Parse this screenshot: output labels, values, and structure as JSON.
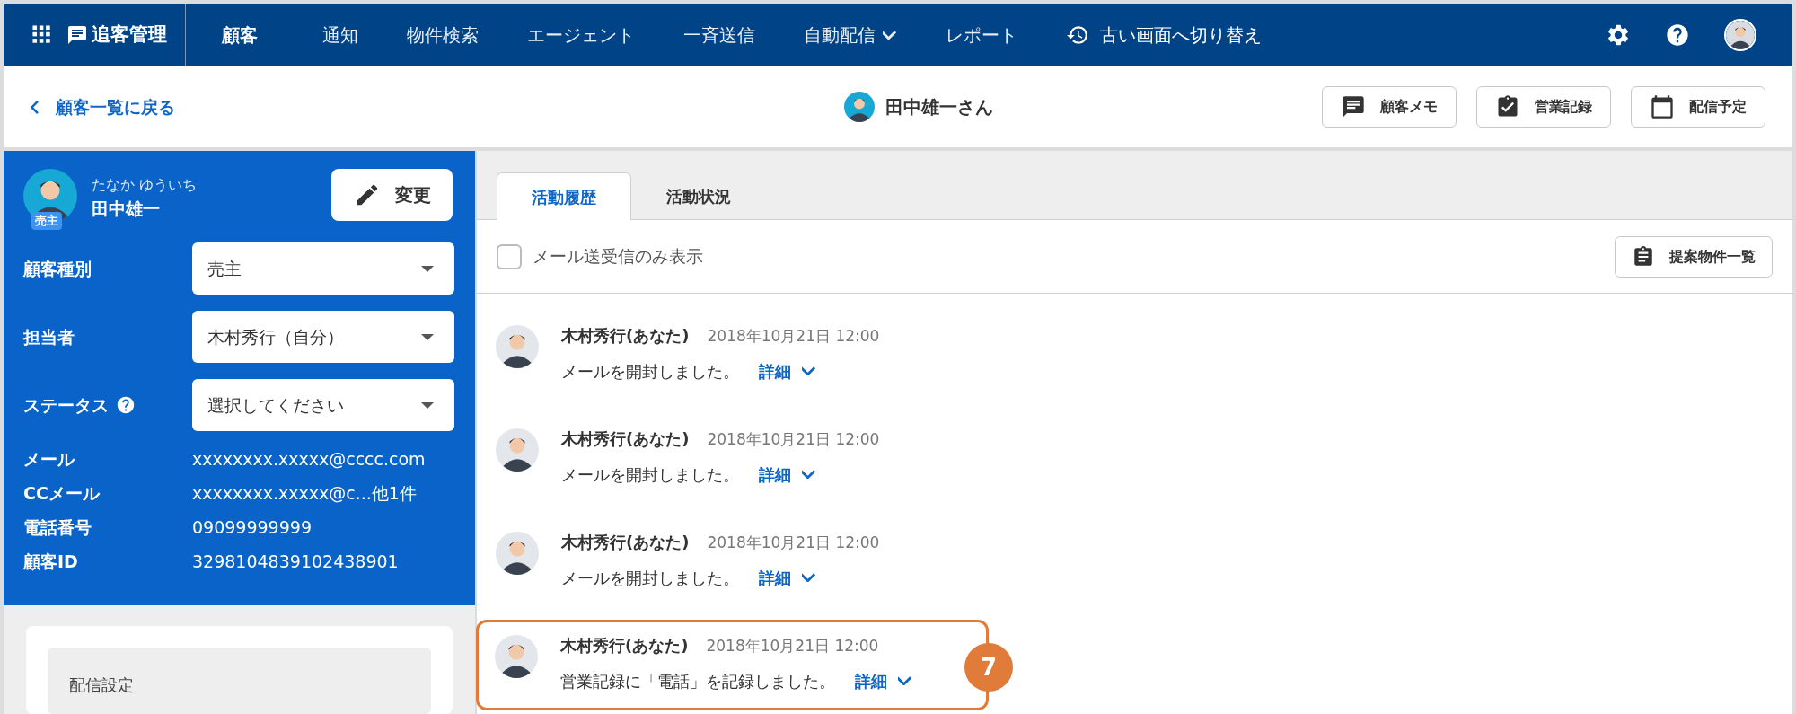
{
  "nav": {
    "app_name": "追客管理",
    "items": [
      {
        "label": "顧客",
        "selected": true,
        "has_menu": false
      },
      {
        "label": "通知",
        "selected": false,
        "has_menu": false
      },
      {
        "label": "物件検索",
        "selected": false,
        "has_menu": false
      },
      {
        "label": "エージェント",
        "selected": false,
        "has_menu": false
      },
      {
        "label": "一斉送信",
        "selected": false,
        "has_menu": false
      },
      {
        "label": "自動配信",
        "selected": false,
        "has_menu": true
      },
      {
        "label": "レポート",
        "selected": false,
        "has_menu": false
      }
    ],
    "switch_link": "古い画面へ切り替え"
  },
  "header": {
    "back_link": "顧客一覧に戻る",
    "customer_name": "田中雄一さん",
    "buttons": [
      {
        "label": "顧客メモ",
        "kind": "memo"
      },
      {
        "label": "営業記録",
        "kind": "record"
      },
      {
        "label": "配信予定",
        "kind": "schedule"
      }
    ]
  },
  "profile": {
    "kana": "たなか ゆういち",
    "name": "田中雄一",
    "badge": "売主",
    "edit_button": "変更",
    "selects": [
      {
        "label": "顧客種別",
        "value": "売主",
        "help": false
      },
      {
        "label": "担当者",
        "value": "木村秀行（自分）",
        "help": false
      },
      {
        "label": "ステータス",
        "value": "選択してください",
        "help": true
      }
    ],
    "info": [
      {
        "label": "メール",
        "value": "xxxxxxxx.xxxxx@cccc.com"
      },
      {
        "label": "CCメール",
        "value": "xxxxxxxx.xxxxx@c...他1件"
      },
      {
        "label": "電話番号",
        "value": "09099999999"
      },
      {
        "label": "顧客ID",
        "value": "3298104839102438901"
      }
    ]
  },
  "settings_card": {
    "title": "配信設定"
  },
  "tabs": [
    {
      "label": "活動履歴",
      "selected": true
    },
    {
      "label": "活動状況",
      "selected": false
    }
  ],
  "filter": {
    "label": "メール送受信のみ表示",
    "checked": false
  },
  "proposal_button": "提案物件一覧",
  "activities": [
    {
      "author": "木村秀行(あなた)",
      "time": "2018年10月21日 12:00",
      "message": "メールを開封しました。",
      "detail_link": "詳細",
      "highlighted": false
    },
    {
      "author": "木村秀行(あなた)",
      "time": "2018年10月21日 12:00",
      "message": "メールを開封しました。",
      "detail_link": "詳細",
      "highlighted": false
    },
    {
      "author": "木村秀行(あなた)",
      "time": "2018年10月21日 12:00",
      "message": "メールを開封しました。",
      "detail_link": "詳細",
      "highlighted": false
    },
    {
      "author": "木村秀行(あなた)",
      "time": "2018年10月21日 12:00",
      "message": "営業記録に「電話」を記録しました。",
      "detail_link": "詳細",
      "highlighted": true,
      "callout": "7"
    }
  ]
}
